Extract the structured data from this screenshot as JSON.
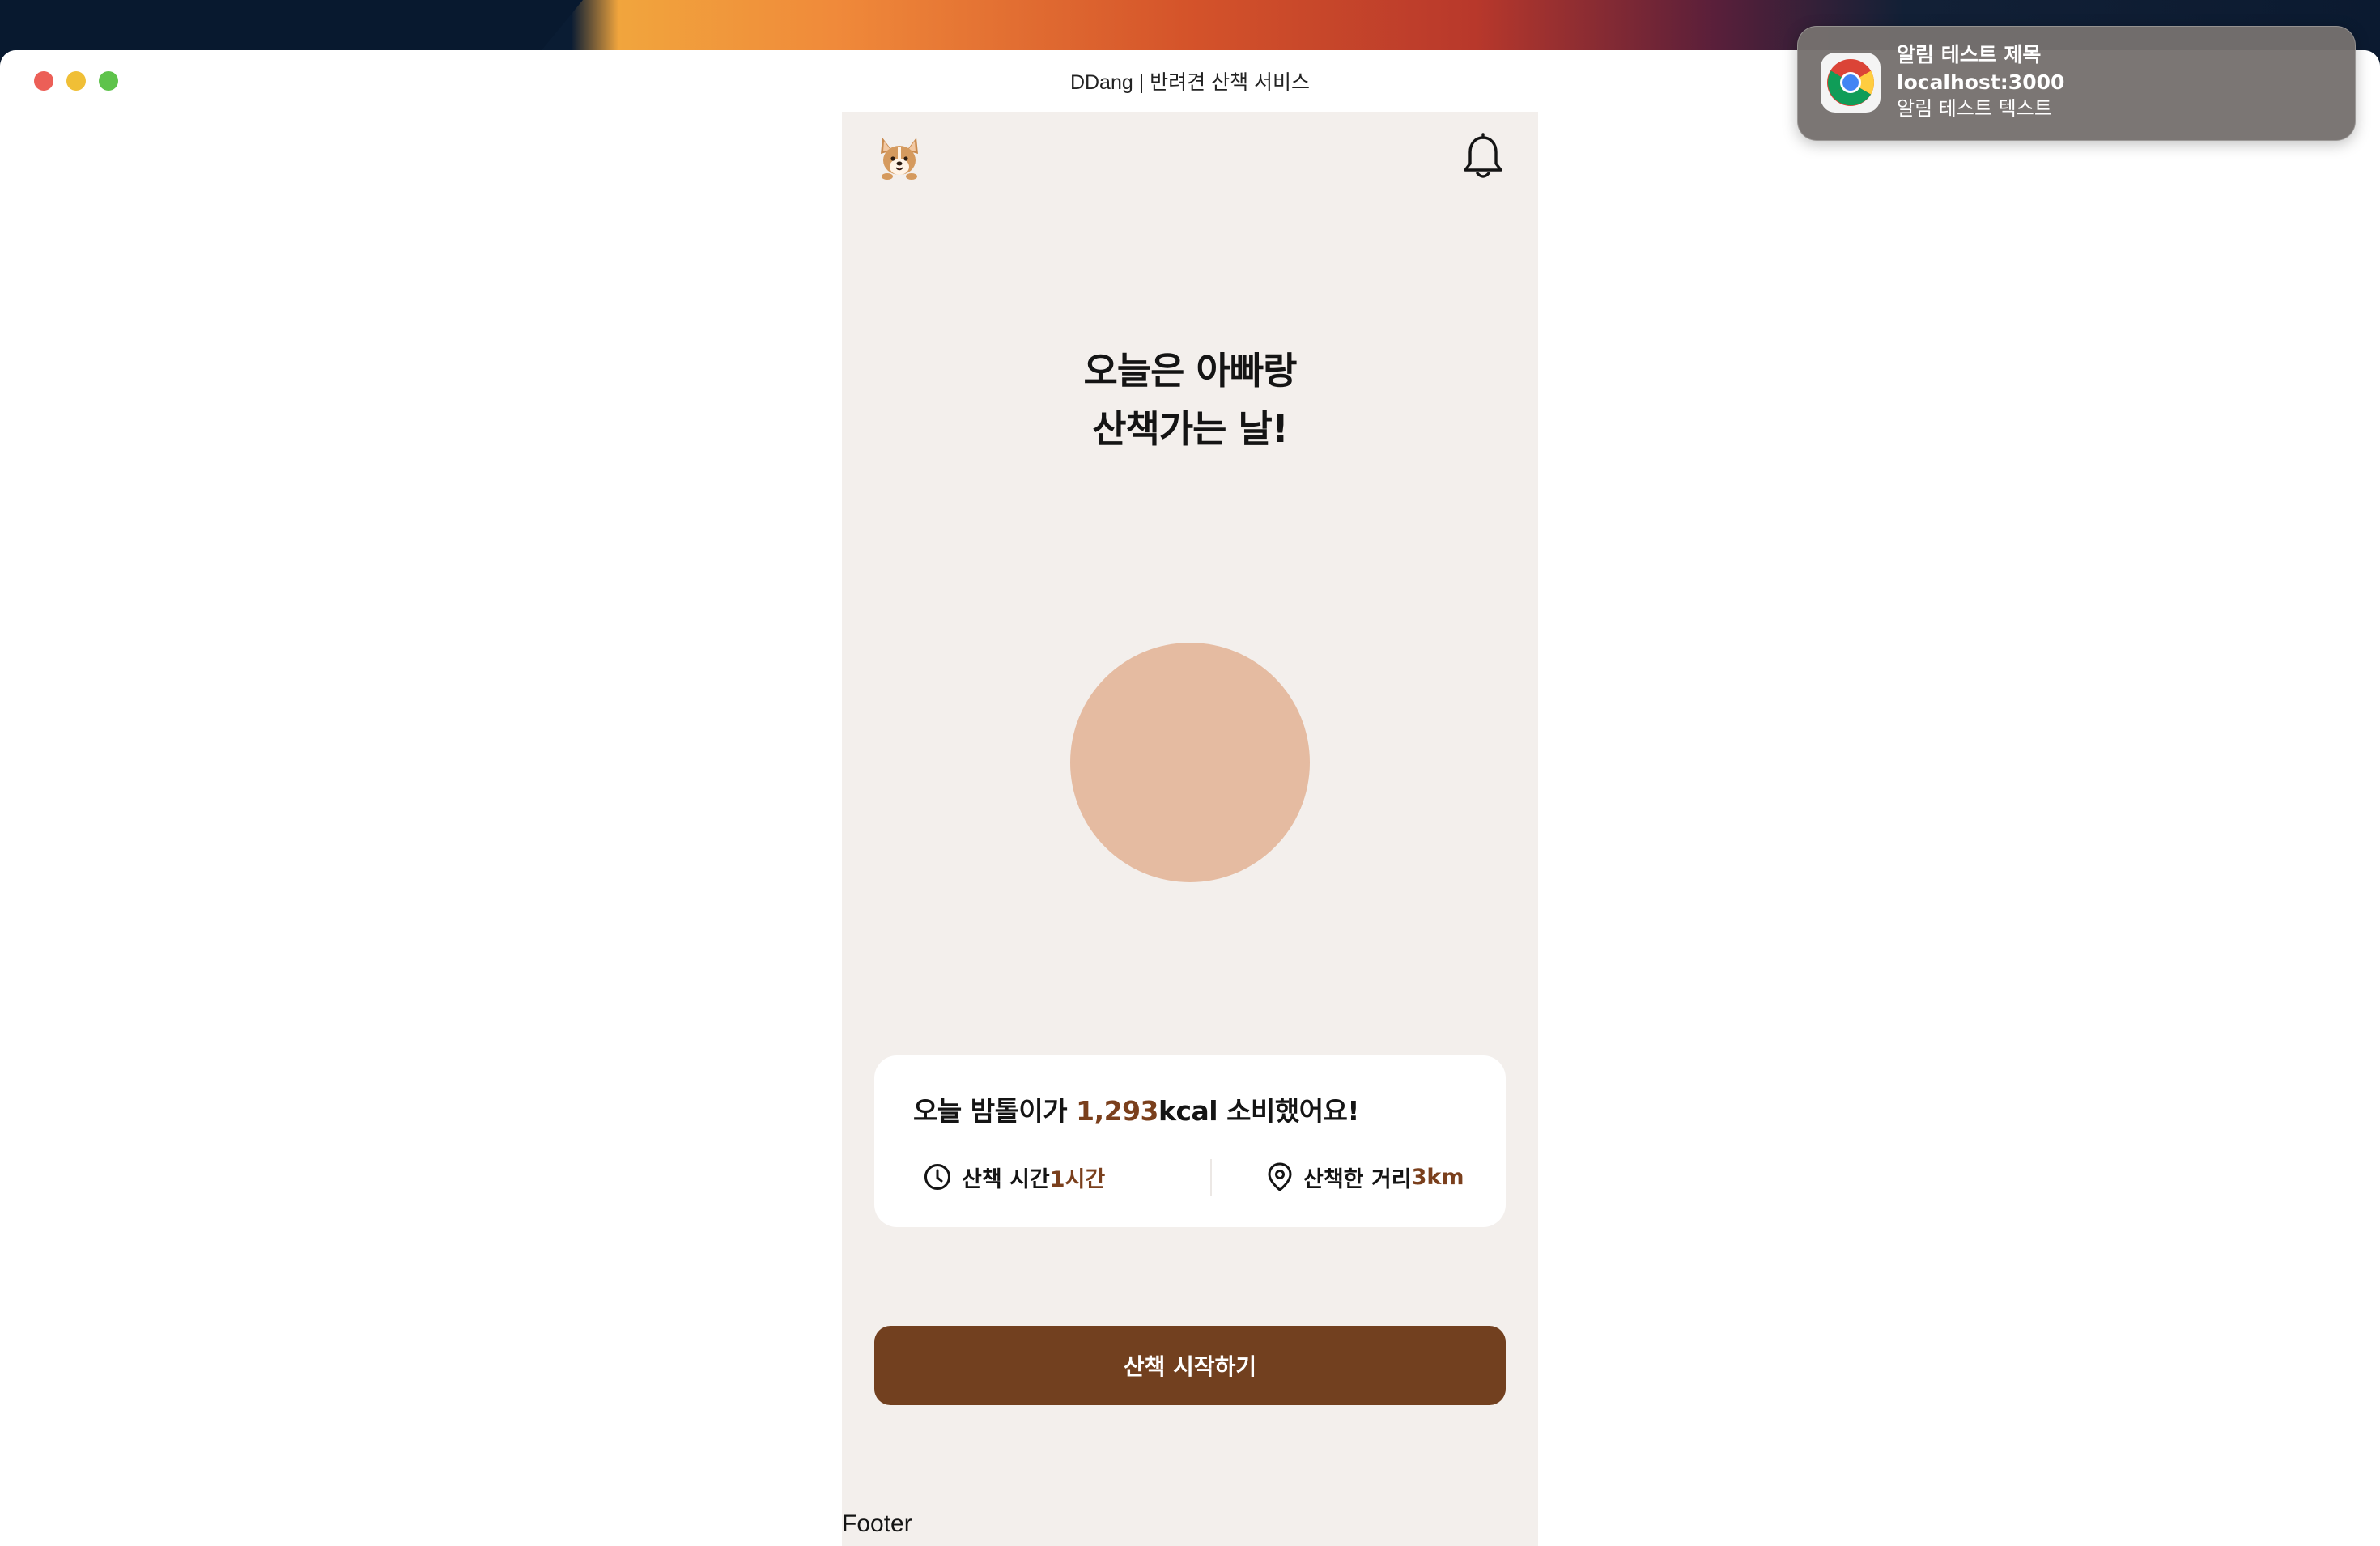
{
  "window": {
    "title": "DDang | 반려견 산책 서비스"
  },
  "app": {
    "headline_line1": "오늘은 아빠랑",
    "headline_line2": "산책가는 날!",
    "summary": {
      "prefix": "오늘 밤톨이가 ",
      "kcal": "1,293",
      "suffix": "kcal 소비했어요!"
    },
    "stats": {
      "time_label": "산책 시간 ",
      "time_value": "1시간",
      "distance_label": "산책한 거리 ",
      "distance_value": "3km"
    },
    "start_button": "산책 시작하기",
    "footer": "Footer"
  },
  "notification": {
    "title": "알림 테스트 제목",
    "source": "localhost:3000",
    "body": "알림 테스트 텍스트",
    "icon": "chrome-icon"
  },
  "colors": {
    "app_background": "#f3efec",
    "accent": "#7a3f1c",
    "button": "#72401f",
    "circle": "#e5bba1"
  }
}
